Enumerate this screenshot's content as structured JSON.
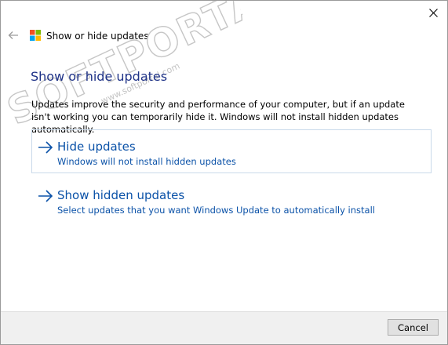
{
  "window": {
    "title": "Show or hide updates",
    "close_icon": "close-icon",
    "back_icon": "back-arrow-icon",
    "app_icon": "windows-logo-icon"
  },
  "content": {
    "heading": "Show or hide updates",
    "description": "Updates improve the security and performance of your computer, but if an update isn't working you can temporarily hide it. Windows will not install hidden updates automatically.",
    "options": [
      {
        "title": "Hide updates",
        "description": "Windows will not install hidden updates"
      },
      {
        "title": "Show hidden updates",
        "description": "Select updates that you want Windows Update to automatically install"
      }
    ]
  },
  "footer": {
    "cancel_label": "Cancel"
  },
  "watermark": {
    "text": "SOFTPORTAL",
    "url": "www.softportal.com",
    "mark": "TM"
  },
  "colors": {
    "link_blue": "#0b52a8",
    "heading_blue": "#1e3287",
    "selected_border": "#c9d9ea",
    "footer_bg": "#f0f0f0"
  }
}
